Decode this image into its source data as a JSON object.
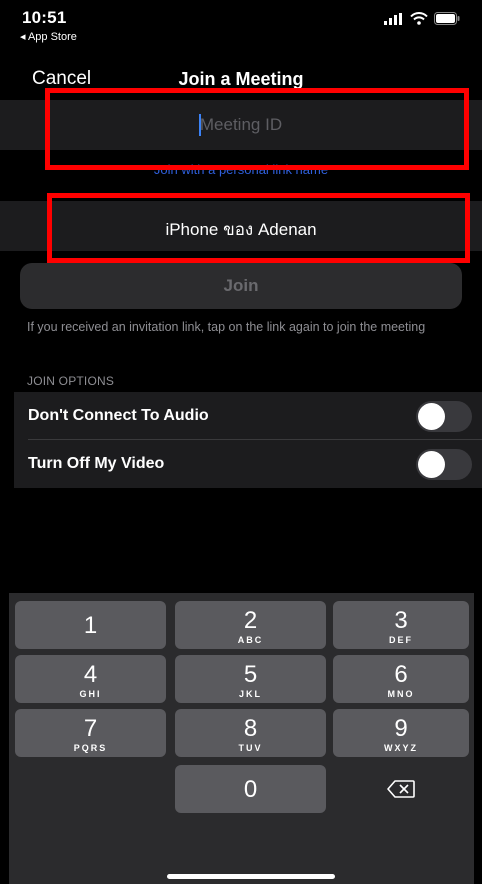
{
  "status_bar": {
    "time": "10:51",
    "back_app": "◂ App Store",
    "icons": [
      "signal-icon",
      "wifi-icon",
      "battery-icon"
    ]
  },
  "nav": {
    "cancel_label": "Cancel",
    "title": "Join a Meeting"
  },
  "meeting_id": {
    "placeholder": "Meeting ID",
    "value": ""
  },
  "personal_link_label": "Join with a personal link name",
  "display_name": {
    "value": "iPhone ของ Adenan"
  },
  "join_button_label": "Join",
  "hint_text": "If you received an invitation link, tap on the link again to join the meeting",
  "join_options": {
    "header": "JOIN OPTIONS",
    "items": [
      {
        "label": "Don't Connect To Audio",
        "on": false
      },
      {
        "label": "Turn Off My Video",
        "on": false
      }
    ]
  },
  "keypad": {
    "keys": [
      {
        "num": "1",
        "letters": ""
      },
      {
        "num": "2",
        "letters": "ABC"
      },
      {
        "num": "3",
        "letters": "DEF"
      },
      {
        "num": "4",
        "letters": "GHI"
      },
      {
        "num": "5",
        "letters": "JKL"
      },
      {
        "num": "6",
        "letters": "MNO"
      },
      {
        "num": "7",
        "letters": "PQRS"
      },
      {
        "num": "8",
        "letters": "TUV"
      },
      {
        "num": "9",
        "letters": "WXYZ"
      },
      {
        "num": "0",
        "letters": ""
      }
    ],
    "delete_icon": "backspace-icon"
  },
  "colors": {
    "highlight_box": "#ff0000",
    "link": "#2f5fdb",
    "caret": "#3b82f6"
  }
}
